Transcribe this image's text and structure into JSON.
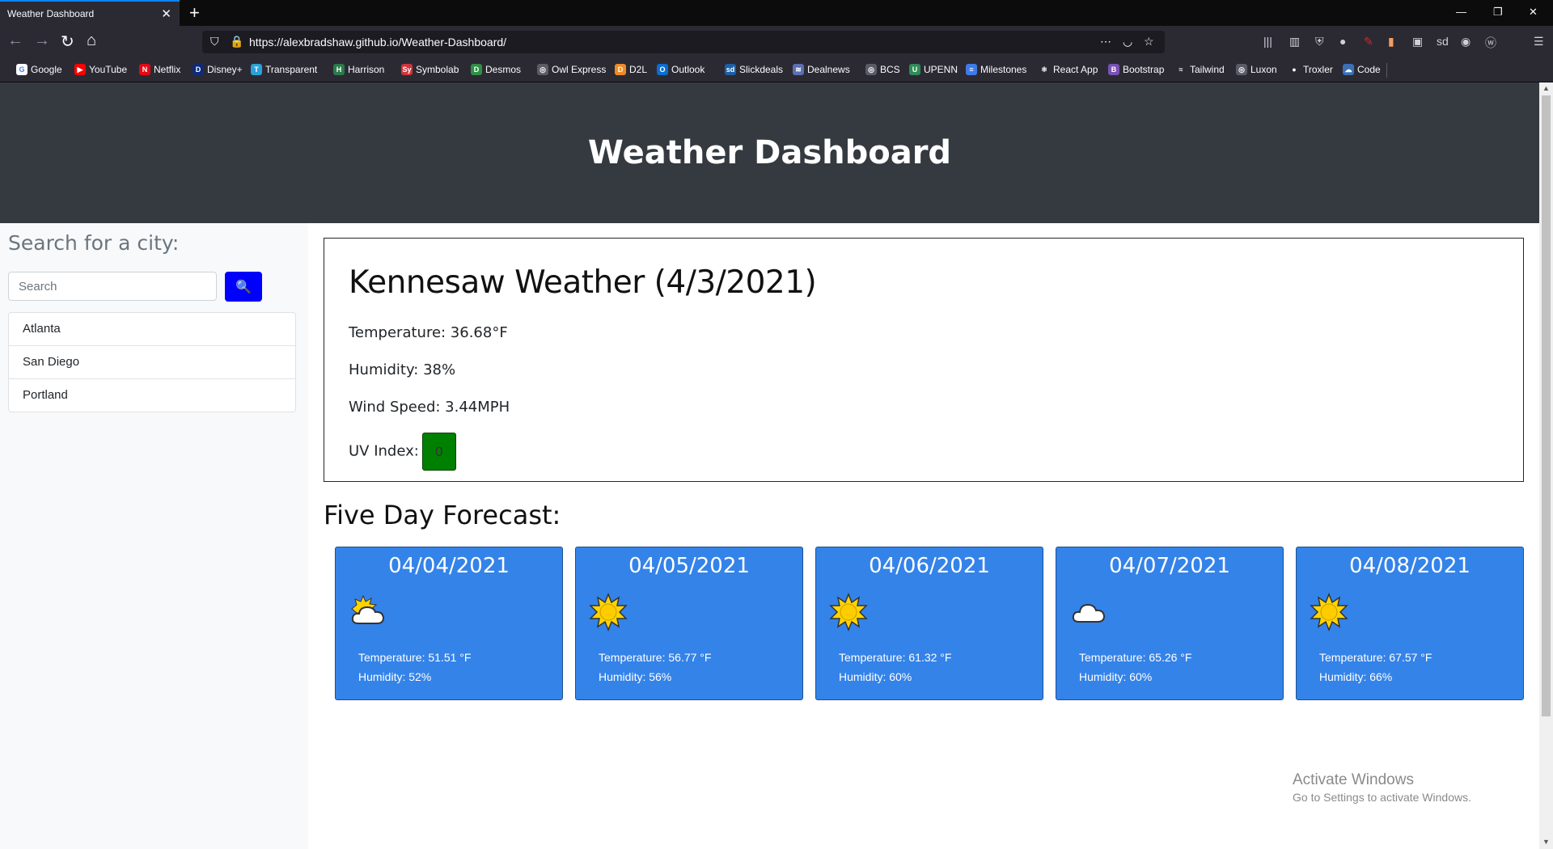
{
  "browser": {
    "tab_title": "Weather Dashboard",
    "tab_close": "✕",
    "new_tab": "+",
    "url": "https://alexbradshaw.github.io/Weather-Dashboard/",
    "bookmarks": [
      {
        "label": "Google",
        "color": "#ffffff",
        "glyph": "G"
      },
      {
        "label": "YouTube",
        "color": "#ff0000",
        "glyph": "▶"
      },
      {
        "label": "Netflix",
        "color": "#e50914",
        "glyph": "N"
      },
      {
        "label": "Disney+",
        "color": "#0e2a7a",
        "glyph": "D"
      },
      {
        "label": "Transparent",
        "color": "#2aa1d8",
        "glyph": "T"
      },
      {
        "label": "Harrison",
        "color": "#2b7a4b",
        "glyph": "H"
      },
      {
        "label": "Symbolab",
        "color": "#d1343b",
        "glyph": "Sy"
      },
      {
        "label": "Desmos",
        "color": "#2f8f46",
        "glyph": "D"
      },
      {
        "label": "Owl Express",
        "color": "#5b5b66",
        "glyph": "◎"
      },
      {
        "label": "D2L",
        "color": "#f08a24",
        "glyph": "D"
      },
      {
        "label": "Outlook",
        "color": "#0a6ed1",
        "glyph": "O"
      },
      {
        "label": "Slickdeals",
        "color": "#1b5fa6",
        "glyph": "sd"
      },
      {
        "label": "Dealnews",
        "color": "#5b6fb3",
        "glyph": "≋"
      },
      {
        "label": "BCS",
        "color": "#5b5b66",
        "glyph": "◎"
      },
      {
        "label": "UPENN",
        "color": "#2e8b57",
        "glyph": "U"
      },
      {
        "label": "Milestones",
        "color": "#3f7be8",
        "glyph": "≡"
      },
      {
        "label": "React App",
        "color": "#2b2a33",
        "glyph": "⚛"
      },
      {
        "label": "Bootstrap",
        "color": "#7952b3",
        "glyph": "B"
      },
      {
        "label": "Tailwind",
        "color": "#2b2a33",
        "glyph": "≈"
      },
      {
        "label": "Luxon",
        "color": "#5b5b66",
        "glyph": "◎"
      },
      {
        "label": "Troxler",
        "color": "#2b2a33",
        "glyph": "●"
      },
      {
        "label": "Code",
        "color": "#3b6fb6",
        "glyph": "☁"
      }
    ]
  },
  "header": {
    "title": "Weather Dashboard"
  },
  "search": {
    "heading": "Search for a city:",
    "placeholder": "Search",
    "value": "",
    "button_icon": "search-icon"
  },
  "cities": [
    "Atlanta",
    "San Diego",
    "Portland"
  ],
  "current": {
    "title": "Kennesaw Weather (4/3/2021)",
    "temperature": "Temperature: 36.68°F",
    "humidity": "Humidity: 38%",
    "wind": "Wind Speed: 3.44MPH",
    "uv_label": "UV Index:",
    "uv_value": "0",
    "uv_color": "#008000"
  },
  "forecast": {
    "title": "Five Day Forecast:",
    "card_color": "#3483e9",
    "days": [
      {
        "date": "04/04/2021",
        "icon": "partly-cloudy-icon",
        "temp": "Temperature: 51.51 °F",
        "humidity": "Humidity: 52%"
      },
      {
        "date": "04/05/2021",
        "icon": "sun-icon",
        "temp": "Temperature: 56.77 °F",
        "humidity": "Humidity: 56%"
      },
      {
        "date": "04/06/2021",
        "icon": "sun-icon",
        "temp": "Temperature: 61.32 °F",
        "humidity": "Humidity: 60%"
      },
      {
        "date": "04/07/2021",
        "icon": "cloud-icon",
        "temp": "Temperature: 65.26 °F",
        "humidity": "Humidity: 60%"
      },
      {
        "date": "04/08/2021",
        "icon": "sun-icon",
        "temp": "Temperature: 67.57 °F",
        "humidity": "Humidity: 66%"
      }
    ]
  },
  "watermark": {
    "title": "Activate Windows",
    "subtitle": "Go to Settings to activate Windows."
  }
}
